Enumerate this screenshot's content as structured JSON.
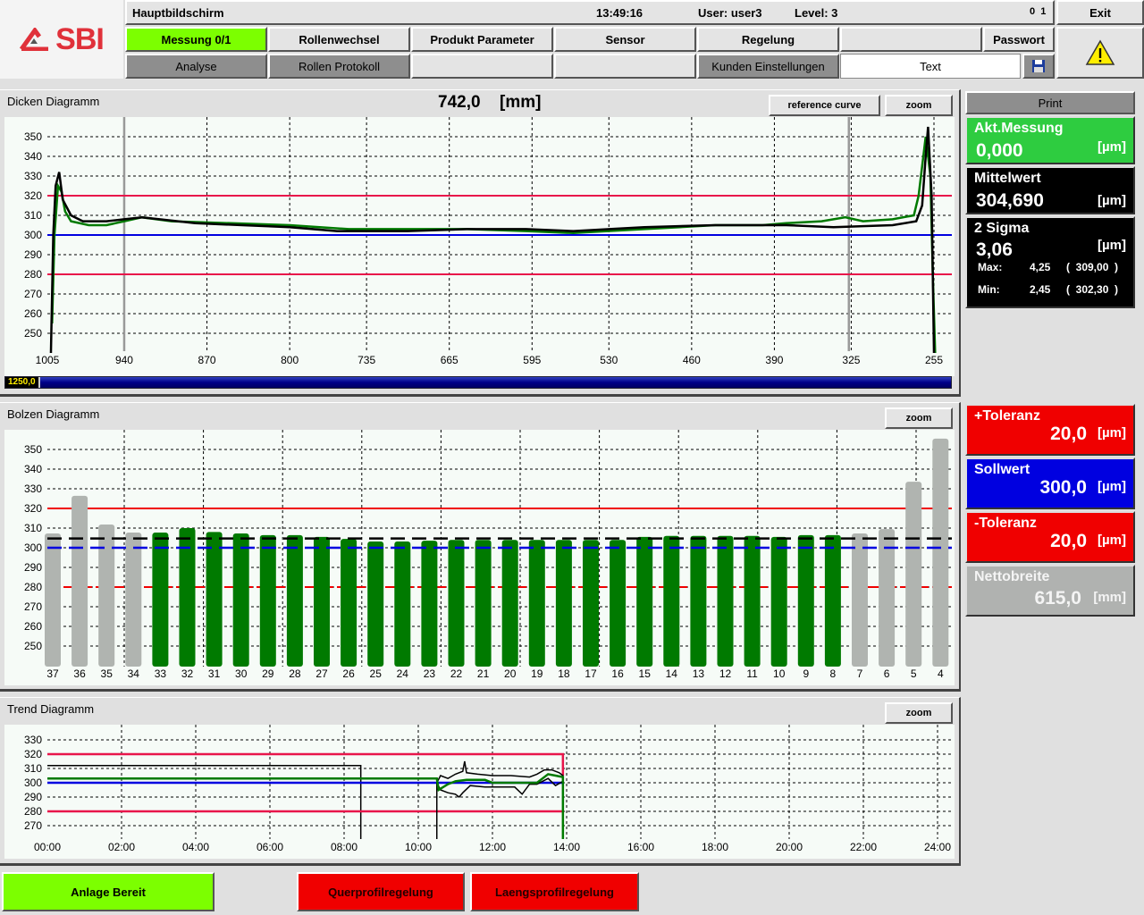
{
  "logo": {
    "text": "SBI",
    "color": "#e0313a"
  },
  "header": {
    "title": "Hauptbildschirm",
    "time": "13:49:16",
    "user": "User: user3",
    "level": "Level: 3",
    "indicator": "0  1",
    "exit": "Exit"
  },
  "nav": {
    "row1": [
      {
        "label": "Messung 0/1",
        "active": true
      },
      {
        "label": "Rollenwechsel"
      },
      {
        "label": "Produkt Parameter"
      },
      {
        "label": "Sensor"
      },
      {
        "label": "Regelung"
      },
      {
        "label": ""
      },
      {
        "label": "Passwort"
      }
    ],
    "row2": [
      {
        "label": "Analyse"
      },
      {
        "label": "Rollen Protokoll"
      },
      {
        "label": ""
      },
      {
        "label": ""
      },
      {
        "label": "Kunden Einstellungen"
      }
    ],
    "text_field": "Text",
    "save_icon": "floppy-disk-icon",
    "warning_icon": "warning-triangle-icon"
  },
  "colors": {
    "accent_green": "#7cff00",
    "measure_green": "#2ecc40",
    "tolerance_red": "#f00000",
    "setpoint_blue": "#0000e0",
    "curve_green": "#007a00",
    "tol_line": "#e8154a"
  },
  "dicken": {
    "title": "Dicken Diagramm",
    "position": "742,0",
    "unit": "[mm]",
    "reference_button": "reference curve",
    "zoom_button": "zoom",
    "progress_label": "1250,0"
  },
  "bolzen": {
    "title": "Bolzen Diagramm",
    "zoom_button": "zoom"
  },
  "trend": {
    "title": "Trend Diagramm",
    "zoom_button": "zoom"
  },
  "right": {
    "print": "Print",
    "akt": {
      "label": "Akt.Messung",
      "value": "0,000",
      "unit": "[µm]"
    },
    "mittel": {
      "label": "Mittelwert",
      "value": "304,690",
      "unit": "[µm]"
    },
    "sigma": {
      "label": "2 Sigma",
      "value": "3,06",
      "unit": "[µm]",
      "max_label": "Max:",
      "max": "4,25",
      "max_abs": "(  309,00  )",
      "min_label": "Min:",
      "min": "2,45",
      "min_abs": "(  302,30  )"
    },
    "plus_tol": {
      "label": "+Toleranz",
      "value": "20,0",
      "unit": "[µm]"
    },
    "soll": {
      "label": "Sollwert",
      "value": "300,0",
      "unit": "[µm]"
    },
    "minus_tol": {
      "label": "-Toleranz",
      "value": "20,0",
      "unit": "[µm]"
    },
    "netto": {
      "label": "Nettobreite",
      "value": "615,0",
      "unit": "[mm]"
    }
  },
  "footer": {
    "anlage": "Anlage Bereit",
    "quer": "Querprofilregelung",
    "laengs": "Laengsprofilregelung"
  },
  "chart_data": [
    {
      "type": "line",
      "title": "Dicken Diagramm",
      "xlim": [
        1005,
        255
      ],
      "ylim": [
        240,
        360
      ],
      "xticks": [
        1005,
        940,
        870,
        800,
        735,
        665,
        595,
        530,
        460,
        390,
        325,
        255
      ],
      "xtick_labels": [
        "1005",
        "940",
        "870",
        "800",
        "735",
        "665",
        "595",
        "530",
        "460",
        "390",
        "325",
        "255"
      ],
      "yticks": [
        250,
        260,
        270,
        280,
        290,
        300,
        310,
        320,
        330,
        340,
        350
      ],
      "grid": true,
      "hlines": {
        "upper_tolerance": 320,
        "setpoint": 300,
        "lower_tolerance": 280
      },
      "markers": [
        940,
        327
      ],
      "series": [
        {
          "color": "#000000",
          "x": [
            1002,
            1000,
            998,
            995,
            992,
            985,
            975,
            955,
            940,
            925,
            910,
            880,
            840,
            800,
            760,
            700,
            650,
            600,
            560,
            500,
            440,
            380,
            340,
            290,
            270,
            265,
            262,
            260,
            257,
            255
          ],
          "y": [
            240,
            300,
            325,
            332,
            318,
            310,
            307,
            307,
            308,
            309,
            308,
            306,
            305,
            304,
            302,
            302,
            303,
            303,
            302,
            304,
            305,
            305,
            304,
            305,
            307,
            315,
            340,
            355,
            320,
            240
          ]
        },
        {
          "color": "#007a00",
          "x": [
            1001,
            999,
            996,
            993,
            990,
            985,
            970,
            955,
            940,
            925,
            900,
            850,
            800,
            750,
            700,
            650,
            600,
            560,
            500,
            440,
            400,
            380,
            350,
            330,
            315,
            290,
            272,
            268,
            262,
            258,
            256,
            254
          ],
          "y": [
            255,
            300,
            325,
            322,
            312,
            307,
            305,
            305,
            307,
            309,
            307,
            306,
            305,
            303,
            303,
            303,
            302,
            301,
            303,
            305,
            305,
            306,
            307,
            309,
            307,
            308,
            310,
            320,
            350,
            330,
            280,
            240
          ]
        }
      ]
    },
    {
      "type": "bar",
      "title": "Bolzen Diagramm",
      "ylim": [
        240,
        360
      ],
      "yticks": [
        250,
        260,
        270,
        280,
        290,
        300,
        310,
        320,
        330,
        340,
        350
      ],
      "grid": true,
      "categories": [
        "37",
        "36",
        "35",
        "34",
        "33",
        "32",
        "31",
        "30",
        "29",
        "28",
        "27",
        "26",
        "25",
        "24",
        "23",
        "22",
        "21",
        "20",
        "19",
        "18",
        "17",
        "16",
        "15",
        "14",
        "13",
        "12",
        "11",
        "10",
        "9",
        "8",
        "7",
        "6",
        "5",
        "4"
      ],
      "values": [
        307.3,
        326.4,
        311.8,
        307.7,
        307.7,
        310,
        308,
        307.3,
        306.4,
        306.4,
        305.5,
        304.5,
        303.2,
        303.2,
        303.6,
        304,
        304,
        304,
        304,
        304,
        304,
        304,
        305.5,
        306,
        306,
        306,
        306,
        305.5,
        306.4,
        306.4,
        307.3,
        309.5,
        333.6,
        355.5
      ],
      "active": [
        false,
        false,
        false,
        false,
        true,
        true,
        true,
        true,
        true,
        true,
        true,
        true,
        true,
        true,
        true,
        true,
        true,
        true,
        true,
        true,
        true,
        true,
        true,
        true,
        true,
        true,
        true,
        true,
        true,
        true,
        false,
        false,
        false,
        false
      ],
      "hlines": {
        "upper_tolerance": 320,
        "mean": 304.7,
        "setpoint": 300,
        "lower_tolerance": 280
      }
    },
    {
      "type": "line",
      "title": "Trend Diagramm",
      "xlim": [
        0,
        24
      ],
      "ylim": [
        260,
        335
      ],
      "xtick_labels": [
        "00:00",
        "02:00",
        "04:00",
        "06:00",
        "08:00",
        "10:00",
        "12:00",
        "14:00",
        "16:00",
        "18:00",
        "20:00",
        "22:00",
        "24:00"
      ],
      "yticks": [
        270,
        280,
        290,
        300,
        310,
        320,
        330
      ],
      "grid": true,
      "series": [
        {
          "color": "#000000",
          "x": [
            0,
            8.45,
            8.45
          ],
          "y": [
            312,
            312,
            260
          ]
        },
        {
          "color": "#0000e0",
          "x": [
            0,
            13.9
          ],
          "y": [
            300,
            300
          ]
        },
        {
          "color": "#e8154a",
          "x": [
            0,
            13.9,
            13.9
          ],
          "y": [
            320,
            320,
            305
          ]
        },
        {
          "color": "#e8154a",
          "x": [
            0,
            13.9
          ],
          "y": [
            280,
            280
          ]
        },
        {
          "color": "#000000",
          "x": [
            10.5,
            10.5,
            10.6,
            10.8,
            11.0,
            11.2,
            11.25,
            11.3,
            11.6,
            12.0,
            12.5,
            13.0,
            13.2,
            13.4,
            13.6,
            13.8,
            13.9,
            13.9
          ],
          "y": [
            260,
            300,
            305,
            303,
            306,
            308,
            315,
            307,
            306,
            305,
            305,
            304,
            306,
            309,
            309,
            307,
            305,
            260
          ]
        },
        {
          "color": "#000000",
          "x": [
            10.5,
            10.6,
            10.8,
            11.0,
            11.1,
            11.2,
            11.4,
            11.8,
            12.2,
            12.6,
            12.8,
            13.0,
            13.2,
            13.5,
            13.7,
            13.9
          ],
          "y": [
            300,
            295,
            293,
            292,
            290,
            293,
            298,
            297,
            297,
            297,
            292,
            299,
            299,
            303,
            298,
            301
          ]
        },
        {
          "color": "#007a00",
          "x": [
            0,
            10.5,
            10.55,
            10.8,
            11.0,
            11.3,
            11.8,
            12.0,
            13.2,
            13.5,
            13.7,
            13.9,
            13.9
          ],
          "y": [
            303,
            303,
            295,
            299,
            301,
            302,
            302,
            300,
            300,
            306,
            305,
            304,
            260
          ]
        }
      ]
    }
  ]
}
